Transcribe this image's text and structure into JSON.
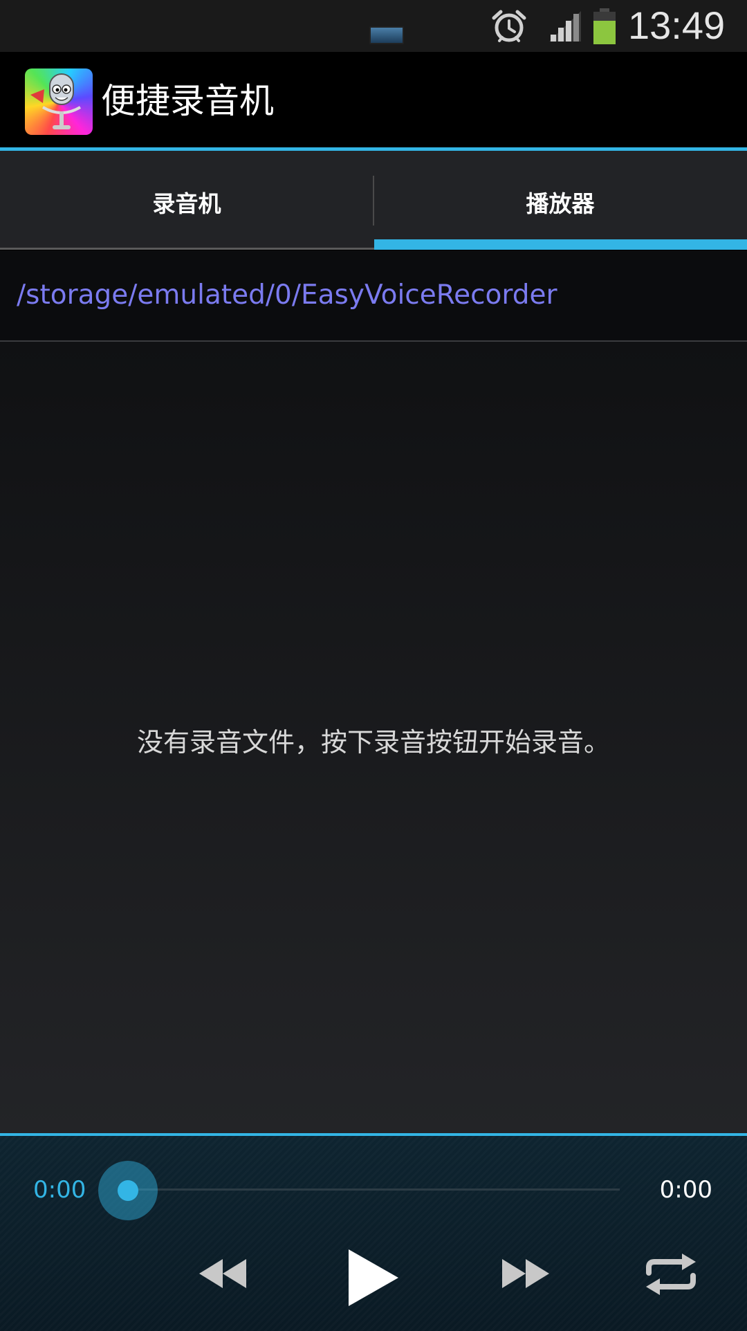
{
  "status_bar": {
    "time": "13:49",
    "icons": [
      "notification-icon",
      "alarm-icon",
      "signal-icon",
      "battery-icon"
    ]
  },
  "action_bar": {
    "app_title": "便捷录音机",
    "app_icon": "app-icon"
  },
  "tabs": [
    {
      "label": "录音机",
      "selected": false
    },
    {
      "label": "播放器",
      "selected": true
    }
  ],
  "path": "/storage/emulated/0/EasyVoiceRecorder",
  "empty_message": "没有录音文件，按下录音按钮开始录音。",
  "player": {
    "current_time": "0:00",
    "total_time": "0:00",
    "progress": 0,
    "controls": [
      "rewind-icon",
      "play-icon",
      "fast-forward-icon",
      "repeat-icon"
    ]
  },
  "colors": {
    "accent": "#33b5e5",
    "path_text": "#7b7bf0"
  }
}
